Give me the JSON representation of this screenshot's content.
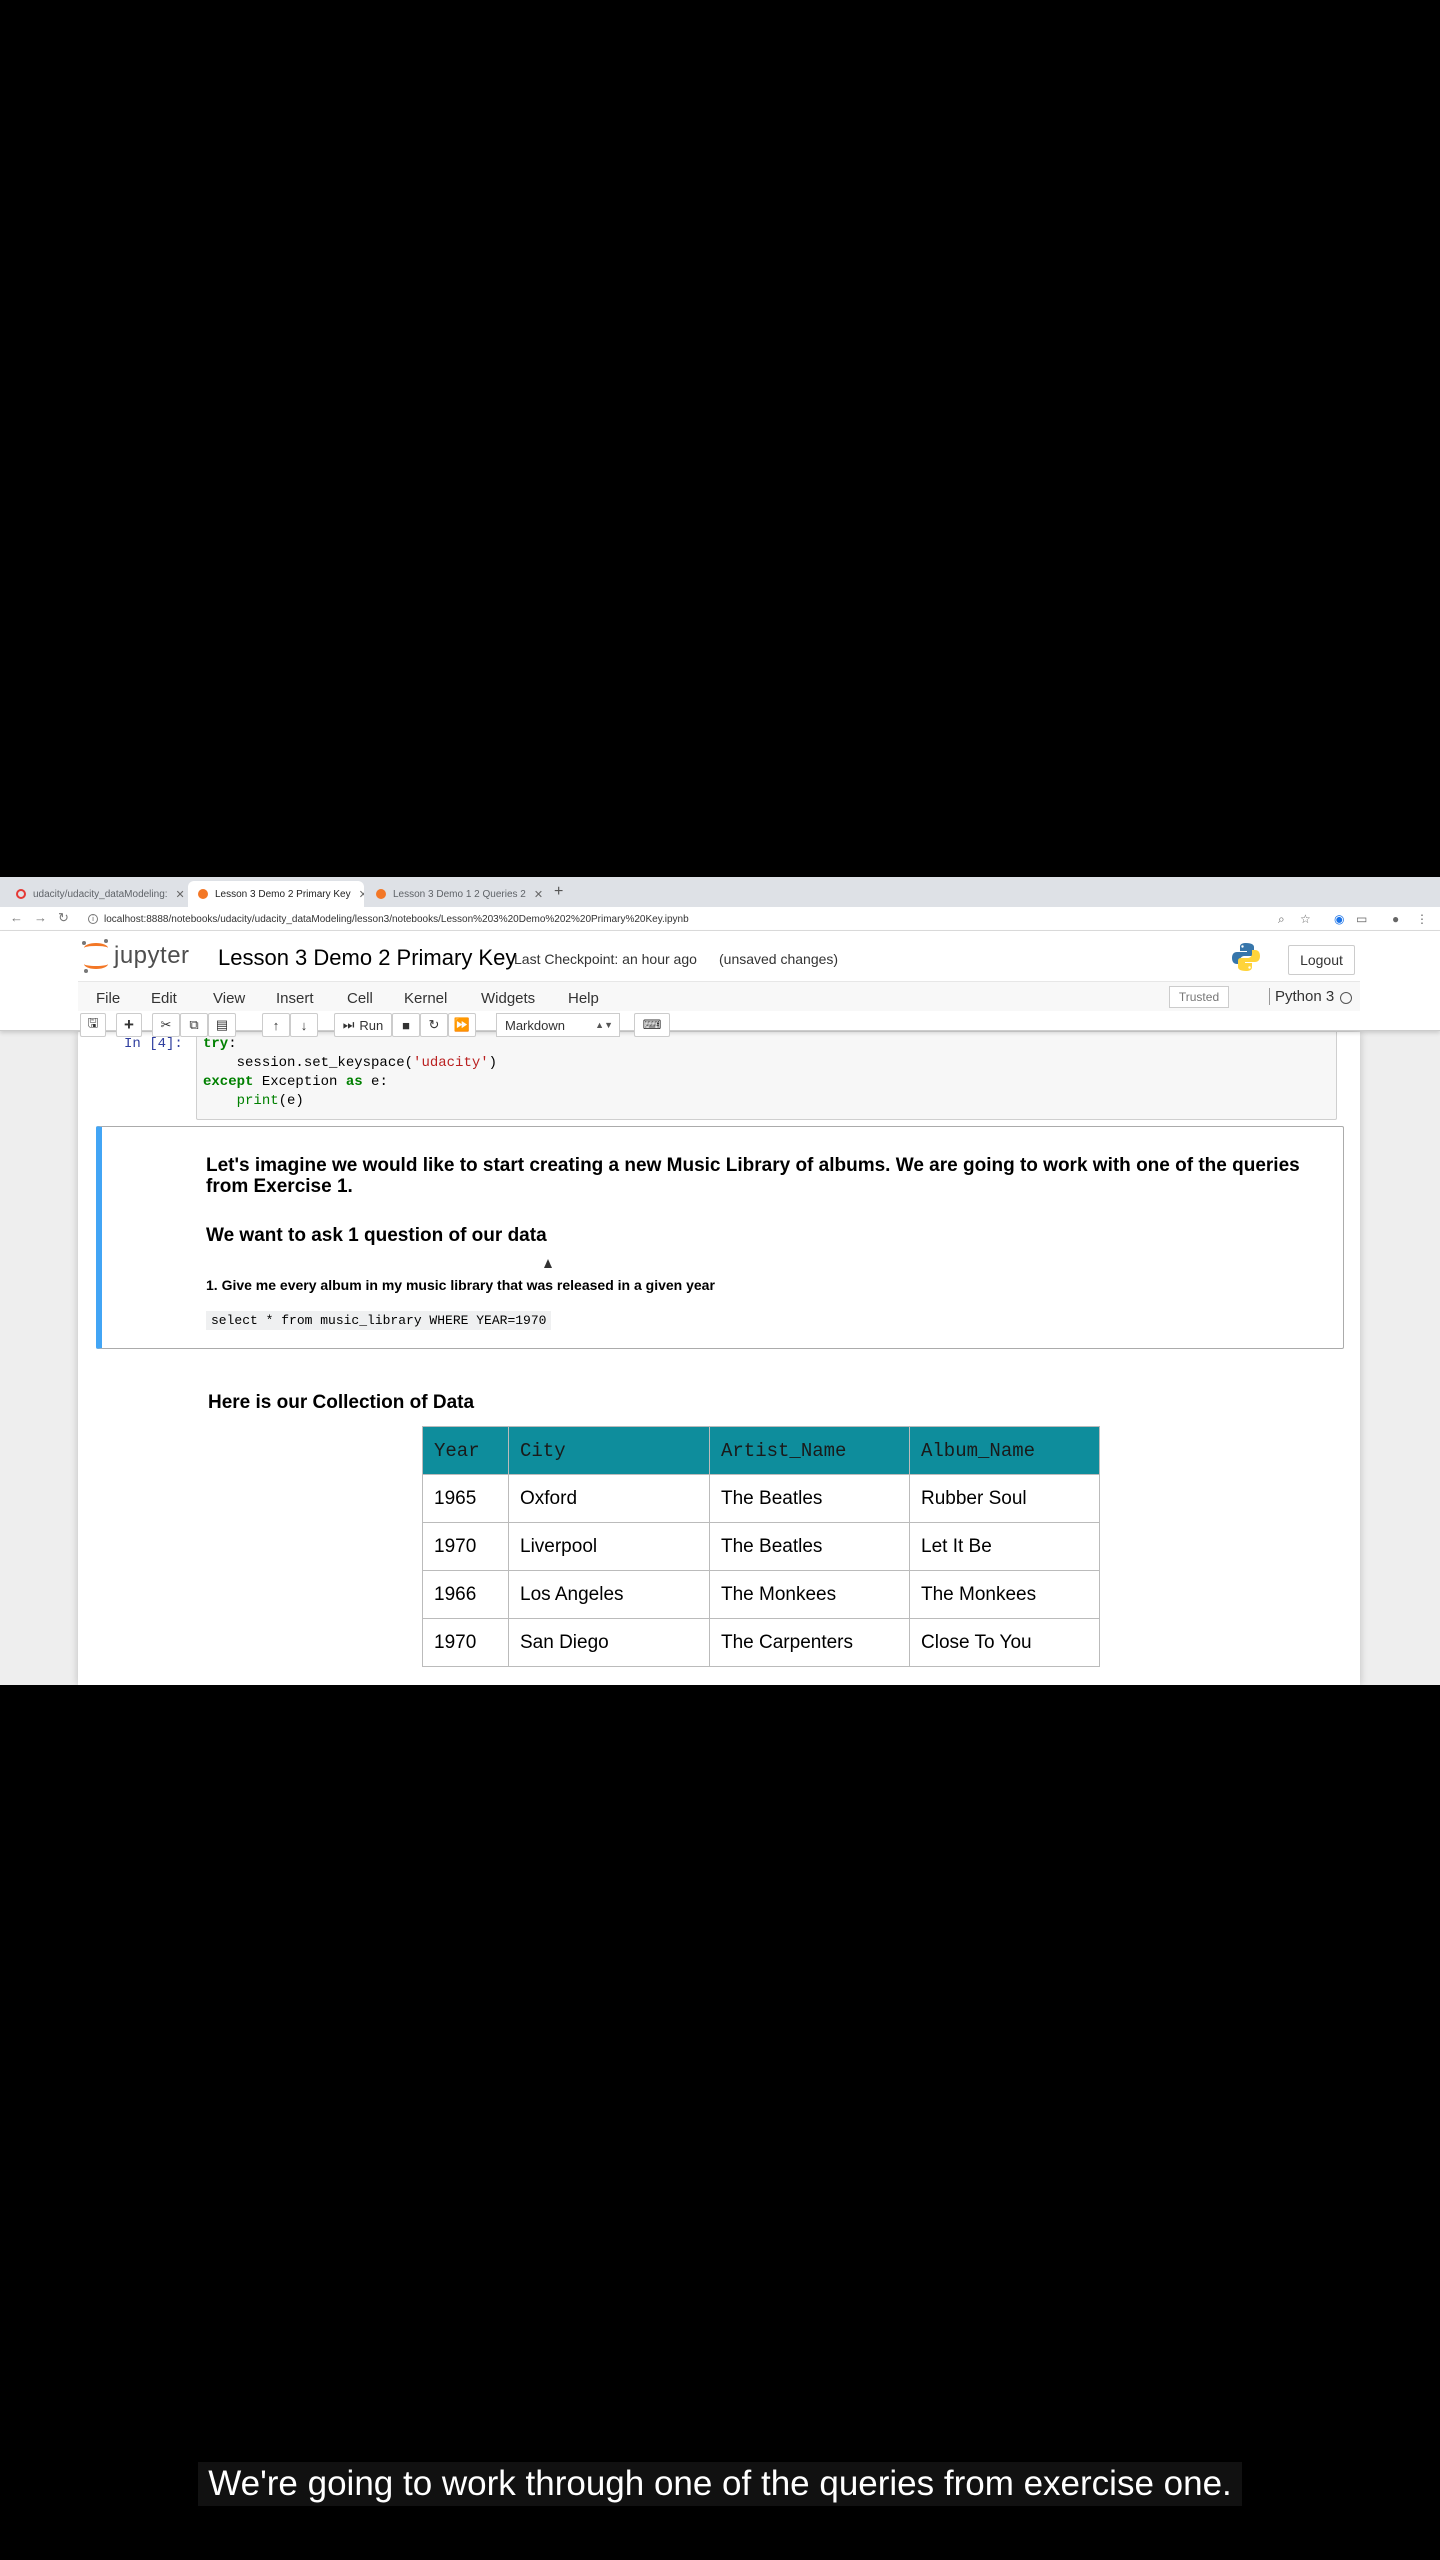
{
  "browser": {
    "tabs": [
      {
        "label": "udacity/udacity_dataModeling:",
        "active": false
      },
      {
        "label": "Lesson 3 Demo 2 Primary Key",
        "active": true
      },
      {
        "label": "Lesson 3 Demo 1 2 Queries 2",
        "active": false
      }
    ],
    "url": "localhost:8888/notebooks/udacity/udacity_dataModeling/lesson3/notebooks/Lesson%203%20Demo%202%20Primary%20Key.ipynb"
  },
  "jupyter": {
    "logo_text": "jupyter",
    "notebook_title": "Lesson 3 Demo 2 Primary Key",
    "checkpoint": "Last Checkpoint: an hour ago",
    "unsaved": "(unsaved changes)",
    "logout_label": "Logout",
    "menu": [
      "File",
      "Edit",
      "View",
      "Insert",
      "Cell",
      "Kernel",
      "Widgets",
      "Help"
    ],
    "trusted_label": "Trusted",
    "kernel_name": "Python 3",
    "run_label": "Run",
    "cell_type": "Markdown"
  },
  "code_cell": {
    "prompt": "In [4]:",
    "lines": [
      {
        "kw": "try",
        "rest": ":"
      },
      {
        "indent": "    ",
        "pre": "session.set_keyspace(",
        "str": "'udacity'",
        "post": ")"
      },
      {
        "kw": "except",
        "mid": " Exception ",
        "kw2": "as",
        "rest": " e:"
      },
      {
        "indent": "    ",
        "bi": "print",
        "rest": "(e)"
      }
    ]
  },
  "markdown_cell": {
    "lead": "Let's imagine we would like to start creating a new Music Library of albums. We are going to work with one of the queries from Exercise 1.",
    "ask_heading": "We want to ask 1 question of our data",
    "question": "1. Give me every album in my music library that was released in a given year",
    "sql": "select * from music_library WHERE YEAR=1970"
  },
  "collection": {
    "heading": "Here is our Collection of Data",
    "columns": [
      "Year",
      "City",
      "Artist_Name",
      "Album_Name"
    ],
    "rows": [
      [
        "1965",
        "Oxford",
        "The Beatles",
        "Rubber Soul"
      ],
      [
        "1970",
        "Liverpool",
        "The Beatles",
        "Let It Be"
      ],
      [
        "1966",
        "Los Angeles",
        "The Monkees",
        "The Monkees"
      ],
      [
        "1970",
        "San Diego",
        "The Carpenters",
        "Close To You"
      ]
    ]
  },
  "caption": "We're going to work through one of the queries from exercise one.",
  "colors": {
    "header_teal": "#0e8d9c",
    "selected_cell": "#42a5f5",
    "logo_orange": "#f37726"
  }
}
